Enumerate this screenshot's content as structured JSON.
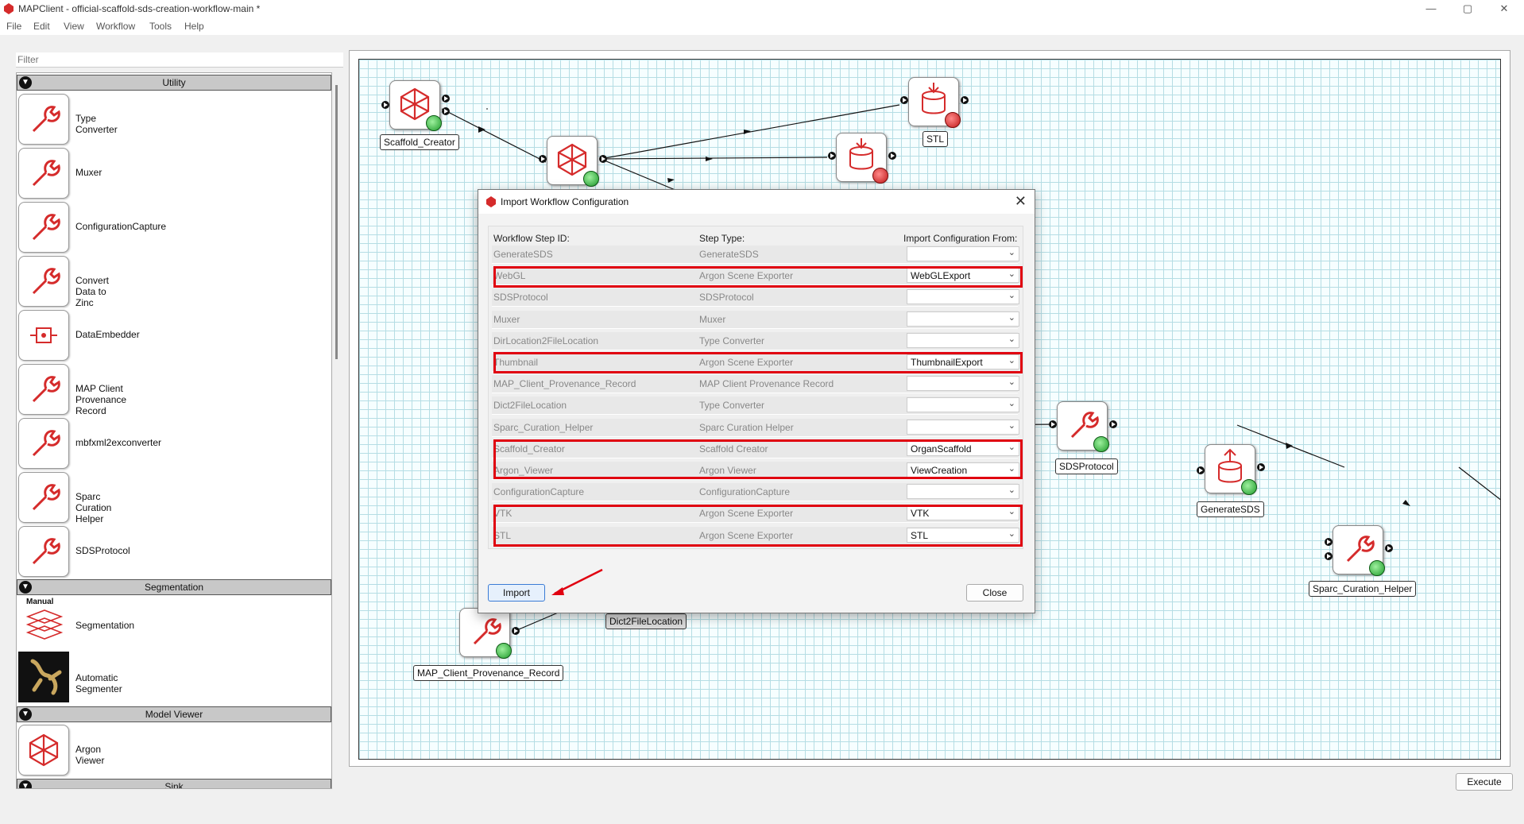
{
  "window": {
    "title": "MAPClient - official-scaffold-sds-creation-workflow-main *",
    "controls": {
      "minimize": "—",
      "maximize": "▢",
      "close": "✕"
    }
  },
  "menu": [
    "File",
    "Edit",
    "View",
    "Workflow",
    "Tools",
    "Help"
  ],
  "filter": {
    "placeholder": "Filter"
  },
  "categories": {
    "utility": "Utility",
    "segmentation": "Segmentation",
    "model_viewer": "Model Viewer",
    "sink": "Sink"
  },
  "plugins": {
    "utility": [
      "Type Converter",
      "Muxer",
      "ConfigurationCapture",
      "Convert Data to Zinc",
      "DataEmbedder",
      "MAP Client Provenance Record",
      "mbfxml2exconverter",
      "Sparc Curation Helper",
      "SDSProtocol"
    ],
    "segmentation": [
      "Segmentation",
      "Automatic Segmenter"
    ],
    "segmentation_manual_tag": "Manual",
    "model_viewer": [
      "Argon Viewer"
    ]
  },
  "workflow_steps": {
    "scaffold_creator": "Scaffold_Creator",
    "stl": "STL",
    "sds_protocol": "SDSProtocol",
    "generate_sds": "GenerateSDS",
    "sparc_curation_helper": "Sparc_Curation_Helper",
    "map_client_provenance_record": "MAP_Client_Provenance_Record",
    "dict2filelocation": "Dict2FileLocation"
  },
  "dialog": {
    "title": "Import Workflow Configuration",
    "close_icon": "✕",
    "headers": {
      "step_id": "Workflow Step ID:",
      "step_type": "Step Type:",
      "import_from": "Import Configuration From:"
    },
    "rows": [
      {
        "id": "GenerateSDS",
        "type": "GenerateSDS",
        "from": ""
      },
      {
        "id": "WebGL",
        "type": "Argon Scene Exporter",
        "from": "WebGLExport"
      },
      {
        "id": "SDSProtocol",
        "type": "SDSProtocol",
        "from": ""
      },
      {
        "id": "Muxer",
        "type": "Muxer",
        "from": ""
      },
      {
        "id": "DirLocation2FileLocation",
        "type": "Type Converter",
        "from": ""
      },
      {
        "id": "Thumbnail",
        "type": "Argon Scene Exporter",
        "from": "ThumbnailExport"
      },
      {
        "id": "MAP_Client_Provenance_Record",
        "type": "MAP Client Provenance Record",
        "from": ""
      },
      {
        "id": "Dict2FileLocation",
        "type": "Type Converter",
        "from": ""
      },
      {
        "id": "Sparc_Curation_Helper",
        "type": "Sparc Curation Helper",
        "from": ""
      },
      {
        "id": "Scaffold_Creator",
        "type": "Scaffold Creator",
        "from": "OrganScaffold"
      },
      {
        "id": "Argon_Viewer",
        "type": "Argon Viewer",
        "from": "ViewCreation"
      },
      {
        "id": "ConfigurationCapture",
        "type": "ConfigurationCapture",
        "from": ""
      },
      {
        "id": "VTK",
        "type": "Argon Scene Exporter",
        "from": "VTK"
      },
      {
        "id": "STL",
        "type": "Argon Scene Exporter",
        "from": "STL"
      }
    ],
    "import_label": "Import",
    "close_label": "Close"
  },
  "execute_label": "Execute",
  "colors": {
    "highlight": "#e00010",
    "accent_red": "#d52b2b",
    "grid": "#b5dde4"
  },
  "icons": [
    "wrench-icon",
    "scaffold-icon",
    "export-icon",
    "upload-icon",
    "embedder-icon",
    "segmentation-icon",
    "chevron-down-icon"
  ]
}
